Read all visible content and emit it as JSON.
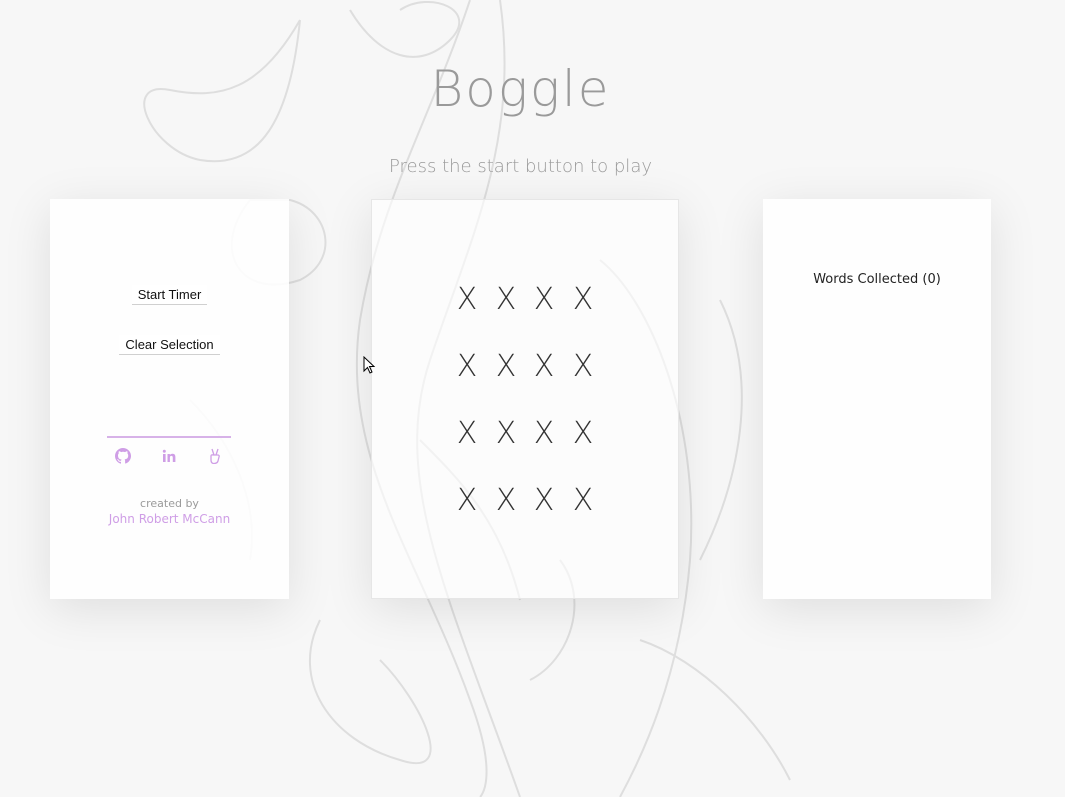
{
  "app": {
    "title": "Boggle",
    "subtitle": "Press the start button to play"
  },
  "controls": {
    "start_label": "Start Timer",
    "clear_label": "Clear Selection"
  },
  "social": {
    "icons": [
      "github-icon",
      "linkedin-icon",
      "angellist-icon"
    ]
  },
  "credit": {
    "prefix": "created by",
    "name": "John Robert McCann"
  },
  "board": {
    "rows": [
      [
        "X",
        "X",
        "X",
        "X"
      ],
      [
        "X",
        "X",
        "X",
        "X"
      ],
      [
        "X",
        "X",
        "X",
        "X"
      ],
      [
        "X",
        "X",
        "X",
        "X"
      ]
    ]
  },
  "words": {
    "header": "Words Collected (0)",
    "list": []
  },
  "colors": {
    "accent": "#cf9ee6",
    "muted_text": "#9a9a9a"
  }
}
